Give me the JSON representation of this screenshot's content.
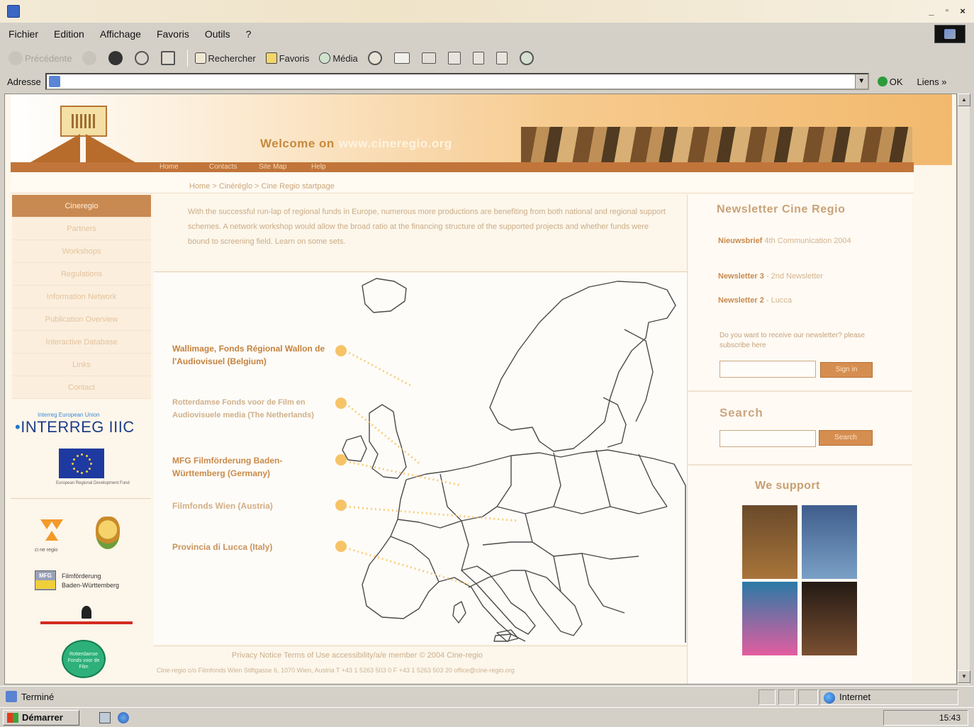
{
  "window": {
    "title": "",
    "controls": [
      "_",
      "×"
    ]
  },
  "menubar": {
    "items": [
      "Fichier",
      "Edition",
      "Affichage",
      "Favoris",
      "Outils",
      "?"
    ]
  },
  "toolbar": {
    "back_label": "Précédente",
    "search_label": "Rechercher",
    "favorites_label": "Favoris",
    "media_label": "Média"
  },
  "address": {
    "label": "Adresse",
    "value": "",
    "go_label": "OK",
    "links_label": "Liens »"
  },
  "page": {
    "welcome_text": "Welcome on",
    "domain_text": "www.cineregio.org",
    "nav_items": [
      "Home",
      "Contacts",
      "Site Map",
      "Help"
    ],
    "breadcrumb": "Home > Cinéréglo > Cine Regio startpage",
    "sidebar_items": [
      "Cineregio",
      "Partners",
      "Workshops",
      "Regulations",
      "Information Network",
      "Publication Overview",
      "Interactive Database",
      "Links",
      "Contact"
    ],
    "interreg_small": "Interreg European Union",
    "interreg_label": "INTERREG IIIC",
    "eu_caption": "European Regional Development Fund",
    "logo_tri_caption": "ci  ne  regio",
    "mfg_box_label": "MFG",
    "mfg_text_line1": "Filmförderung",
    "mfg_text_line2": "Baden-Württemberg",
    "green_logo_text": "Rotterdamse Fonds voor de Film",
    "intro_text": "With the successful run-lap of regional funds in Europe, numerous more productions are benefiting from both national and regional support schemes. A network workshop would allow the broad ratio at the financing structure of the supported projects and whether funds were bound to screening field. Learn on some sets.",
    "partners": [
      {
        "text": "Wallimage, Fonds Régional Wallon de l'Audiovisuel (Belgium)",
        "color": "#c4823e"
      },
      {
        "text": "Rotterdamse Fonds voor de Film en Audiovisuele media (The Netherlands)",
        "color": "#cfb08b"
      },
      {
        "text": "MFG Filmförderung Baden-Württemberg (Germany)",
        "color": "#c98a4a"
      },
      {
        "text": "Filmfonds Wien (Austria)",
        "color": "#d2ae86"
      },
      {
        "text": "Provincia di Lucca (Italy)",
        "color": "#c9935a"
      }
    ],
    "footer_line1": "Privacy Notice   Terms of Use   accessibility/a/e   member   © 2004 Cine-regio",
    "footer_line2": "Cine-regio c/o Filmfonds Wien   Stiftgasse 6, 1070 Wien, Austria   T +43 1 5263 503 0   F +43 1 5263 503 20   office@cine-regio.org",
    "newsletter": {
      "title": "Newsletter Cine Regio",
      "items": [
        {
          "label": "Nieuwsbrief",
          "rest": "4th Communication 2004"
        },
        {
          "label": "Newsletter 3",
          "rest": "- 2nd Newsletter"
        },
        {
          "label": "Newsletter 2",
          "rest": "- Lucca"
        }
      ],
      "ask": "Do you want to receive our newsletter? please subscribe here",
      "button": "Sign in"
    },
    "search": {
      "title": "Search",
      "button": "Search"
    },
    "support_title": "We support",
    "posters": [
      {
        "color_top": "#6a4a2a",
        "color_bottom": "#a8753a"
      },
      {
        "color_top": "#3f5d8c",
        "color_bottom": "#7aa0c6"
      },
      {
        "color_top": "#2a7aa6",
        "color_bottom": "#e35da0"
      },
      {
        "color_top": "#241a14",
        "color_bottom": "#7a5032"
      }
    ]
  },
  "status": {
    "text": "Terminé",
    "zone": "Internet"
  },
  "taskbar": {
    "start_label": "Démarrer",
    "clock": "15:43"
  },
  "colors": {
    "accent_orange": "#c2753a",
    "header_gradient_end": "#f2b96d"
  }
}
